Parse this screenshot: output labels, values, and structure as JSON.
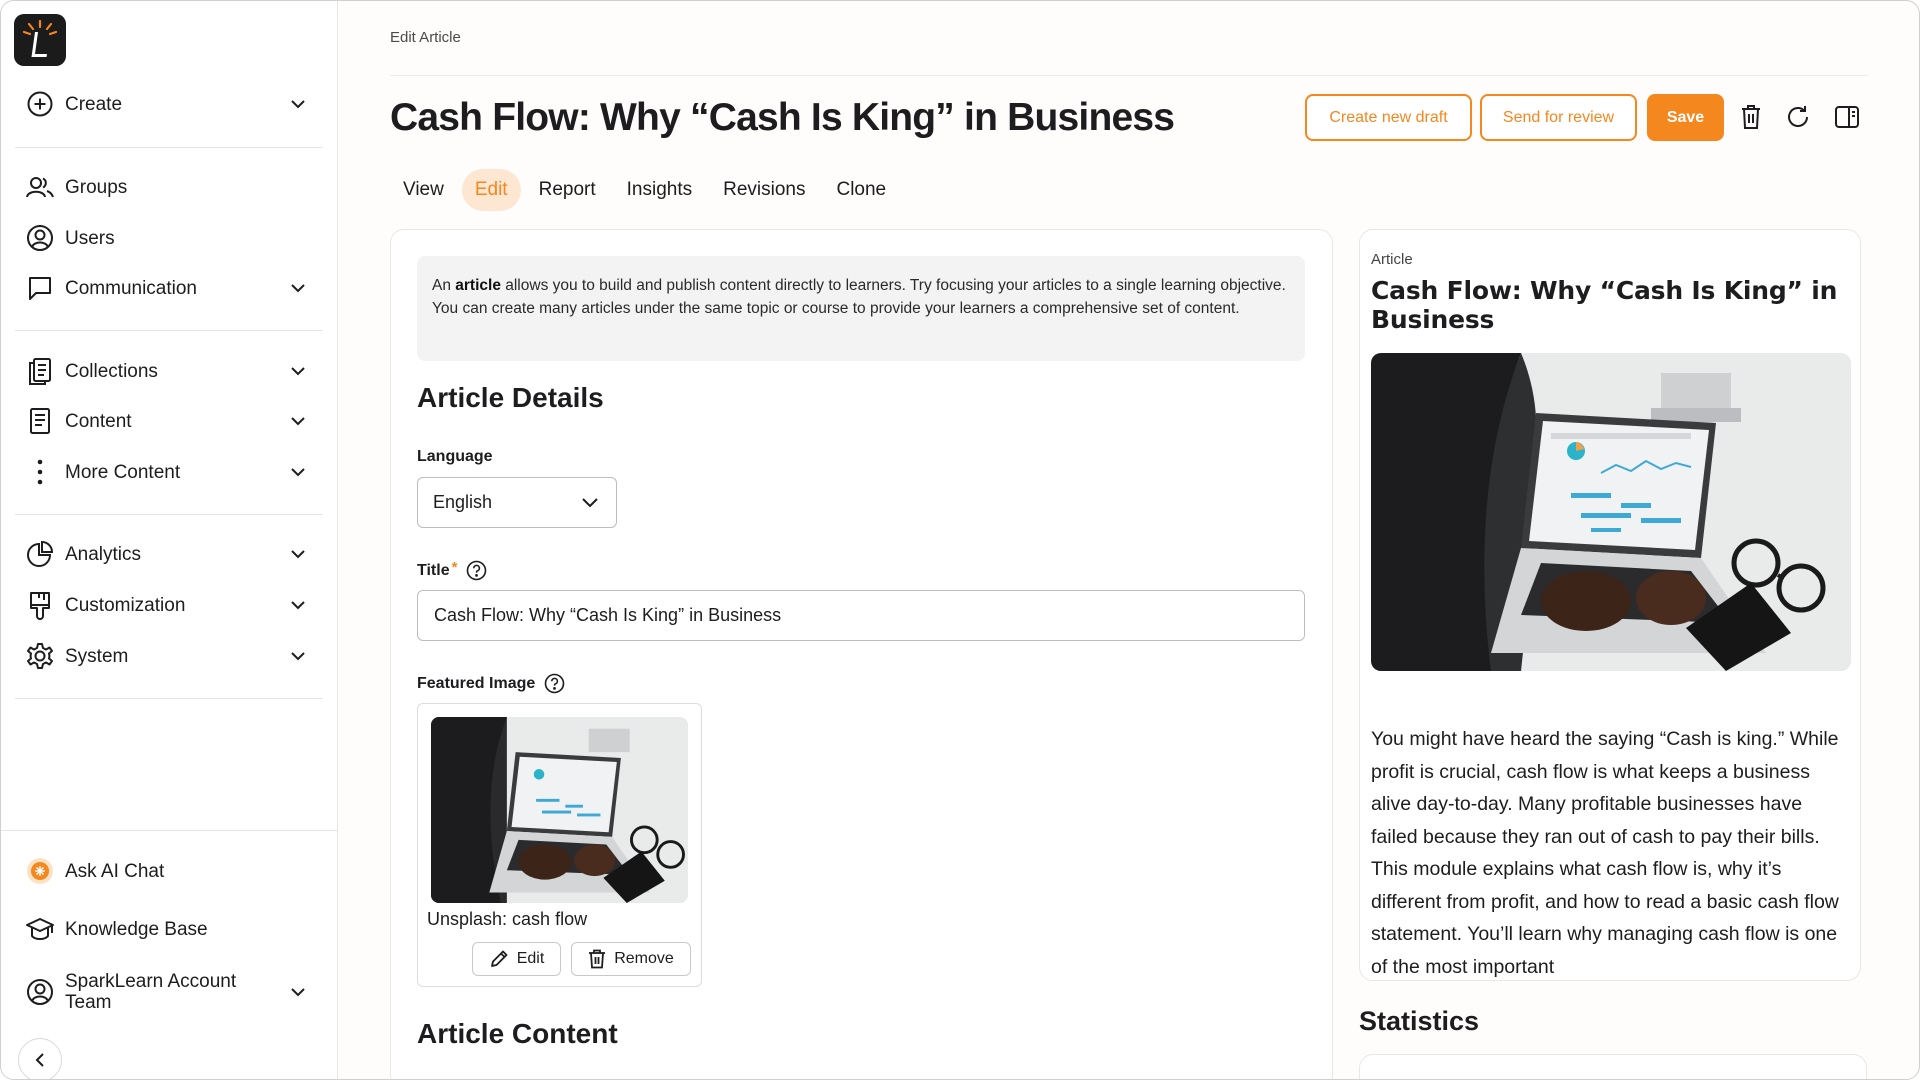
{
  "sidebar": {
    "items": [
      {
        "label": "Create",
        "icon": "plus-circle-icon"
      },
      {
        "label": "Groups",
        "icon": "groups-icon"
      },
      {
        "label": "Users",
        "icon": "user-icon"
      },
      {
        "label": "Communication",
        "icon": "chat-bubble-icon"
      },
      {
        "label": "Collections",
        "icon": "collections-icon"
      },
      {
        "label": "Content",
        "icon": "document-icon"
      },
      {
        "label": "More Content",
        "icon": "more-vertical-icon"
      },
      {
        "label": "Analytics",
        "icon": "pie-chart-icon"
      },
      {
        "label": "Customization",
        "icon": "paint-brush-icon"
      },
      {
        "label": "System",
        "icon": "gear-icon"
      }
    ],
    "bottom": [
      {
        "label": "Ask AI Chat",
        "icon": "ai-chat-icon"
      },
      {
        "label": "Knowledge Base",
        "icon": "graduation-cap-icon"
      },
      {
        "label": "SparkLearn Account Team",
        "icon": "account-icon"
      }
    ]
  },
  "header": {
    "breadcrumb": "Edit Article",
    "title": "Cash Flow: Why “Cash Is King” in Business",
    "create_draft_label": "Create new draft",
    "send_review_label": "Send for review",
    "save_label": "Save"
  },
  "tabs": [
    {
      "label": "View",
      "active": false
    },
    {
      "label": "Edit",
      "active": true
    },
    {
      "label": "Report",
      "active": false
    },
    {
      "label": "Insights",
      "active": false
    },
    {
      "label": "Revisions",
      "active": false
    },
    {
      "label": "Clone",
      "active": false
    }
  ],
  "editor": {
    "info_prefix": "An ",
    "info_bold": "article",
    "info_rest": " allows you to build and publish content directly to learners. Try focusing your articles to a single learning objective. You can create many articles under the same topic or course to provide your learners a comprehensive set of content.",
    "details_heading": "Article Details",
    "language_label": "Language",
    "language_value": "English",
    "title_label": "Title",
    "title_required": "*",
    "title_value": "Cash Flow: Why “Cash Is King” in Business",
    "featured_label": "Featured Image",
    "image_caption": "Unsplash: cash flow",
    "edit_label": "Edit",
    "remove_label": "Remove",
    "content_heading": "Article Content"
  },
  "preview": {
    "type_label": "Article",
    "title": "Cash Flow: Why “Cash Is King” in Business",
    "body": "You might have heard the saying “Cash is king.” While profit is crucial, cash flow is what keeps a business alive day-to-day. Many profitable businesses have failed because they ran out of cash to pay their bills. This module explains what cash flow is, why it’s different from profit, and how to read a basic cash flow statement. You’ll learn why managing cash flow is one of the most important"
  },
  "statistics_heading": "Statistics",
  "colors": {
    "accent": "#f5871f",
    "accent_light": "#fde7d3",
    "text": "#1d1d1f"
  }
}
